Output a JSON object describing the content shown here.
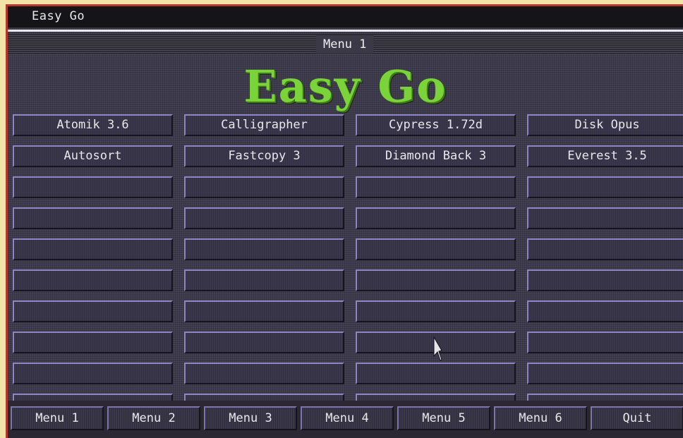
{
  "window": {
    "title": "Easy Go"
  },
  "menu_heading": "Menu 1",
  "logo_text": "Easy Go",
  "colors": {
    "logo": "#7bd33a",
    "border": "#b23a2c",
    "background": "#3d3a4c"
  },
  "programs": [
    {
      "label": "Atomik 3.6"
    },
    {
      "label": "Calligrapher"
    },
    {
      "label": "Cypress 1.72d"
    },
    {
      "label": "Disk Opus"
    },
    {
      "label": "Autosort"
    },
    {
      "label": "Fastcopy 3"
    },
    {
      "label": "Diamond Back 3"
    },
    {
      "label": "Everest 3.5"
    },
    {
      "label": ""
    },
    {
      "label": ""
    },
    {
      "label": ""
    },
    {
      "label": ""
    },
    {
      "label": ""
    },
    {
      "label": ""
    },
    {
      "label": ""
    },
    {
      "label": ""
    },
    {
      "label": ""
    },
    {
      "label": ""
    },
    {
      "label": ""
    },
    {
      "label": ""
    },
    {
      "label": ""
    },
    {
      "label": ""
    },
    {
      "label": ""
    },
    {
      "label": ""
    },
    {
      "label": ""
    },
    {
      "label": ""
    },
    {
      "label": ""
    },
    {
      "label": ""
    },
    {
      "label": ""
    },
    {
      "label": ""
    },
    {
      "label": ""
    },
    {
      "label": ""
    },
    {
      "label": ""
    },
    {
      "label": ""
    },
    {
      "label": ""
    },
    {
      "label": ""
    },
    {
      "label": ""
    },
    {
      "label": ""
    },
    {
      "label": ""
    },
    {
      "label": ""
    }
  ],
  "bottom_buttons": [
    {
      "label": "Menu 1"
    },
    {
      "label": "Menu 2"
    },
    {
      "label": "Menu 3"
    },
    {
      "label": "Menu 4"
    },
    {
      "label": "Menu 5"
    },
    {
      "label": "Menu 6"
    },
    {
      "label": "Quit"
    }
  ],
  "cursor_icon": "mouse-pointer-icon"
}
